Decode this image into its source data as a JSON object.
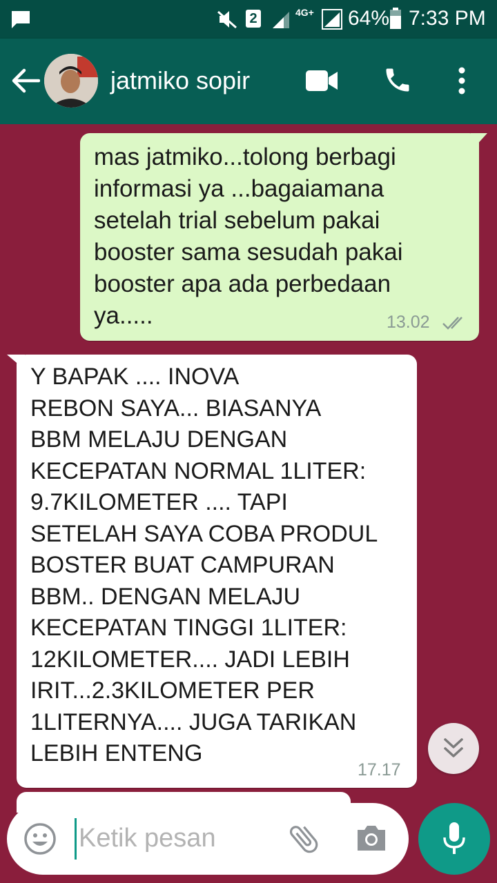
{
  "status_bar": {
    "sim_badge": "2",
    "network": "4G+",
    "battery_percent": "64%",
    "time": "7:33 PM"
  },
  "header": {
    "contact_name": "jatmiko sopir"
  },
  "messages": [
    {
      "direction": "outgoing",
      "text": "mas jatmiko...tolong berbagi\ninformasi ya ...bagaiamana\nsetelah trial sebelum pakai\nbooster sama sesudah pakai\nbooster apa ada perbedaan\nya.....",
      "time": "13.02"
    },
    {
      "direction": "incoming",
      "text": "Y BAPAK .... INOVA\nREBON SAYA... BIASANYA\nBBM MELAJU DENGAN\nKECEPATAN NORMAL 1LITER:\n9.7KILOMETER .... TAPI\nSETELAH SAYA COBA PRODUL\nBOSTER BUAT CAMPURAN\nBBM.. DENGAN MELAJU\nKECEPATAN TINGGI 1LITER:\n12KILOMETER.... JADI LEBIH\nIRIT...2.3KILOMETER PER\n1LITERNYA.... JUGA TARIKAN\nLEBIH ENTENG",
      "time": "17.17"
    }
  ],
  "composer": {
    "placeholder": "Ketik pesan"
  },
  "colors": {
    "header": "#075e54",
    "status_bar": "#054d44",
    "chat_background": "#8a1e3c",
    "outgoing_bubble": "#dcf8c6",
    "incoming_bubble": "#ffffff",
    "accent": "#0f9a88"
  },
  "icons": [
    "chat-notification-icon",
    "mute-icon",
    "signal-icon",
    "battery-icon",
    "back-arrow-icon",
    "video-call-icon",
    "phone-icon",
    "more-vert-icon",
    "double-check-icon",
    "scroll-down-icon",
    "emoji-icon",
    "attach-icon",
    "camera-icon",
    "mic-icon"
  ]
}
